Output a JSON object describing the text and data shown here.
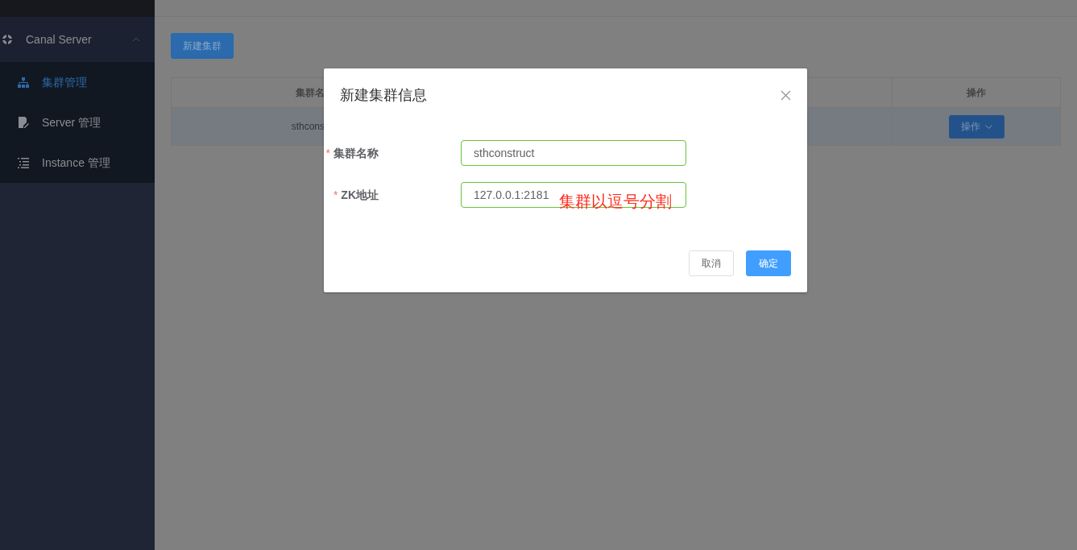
{
  "sidebar": {
    "group": {
      "label": "Canal Server",
      "expanded": true
    },
    "items": [
      {
        "label": "集群管理",
        "selected": true
      },
      {
        "label": "Server 管理",
        "selected": false
      },
      {
        "label": "Instance 管理",
        "selected": false
      }
    ]
  },
  "toolbar": {
    "new_button": "新建集群"
  },
  "table": {
    "columns": [
      "集群名",
      "操作"
    ],
    "rows": [
      {
        "cells": [
          "sthcons"
        ],
        "action": "操作"
      }
    ]
  },
  "dialog": {
    "title": "新建集群信息",
    "fields": [
      {
        "label": "集群名称",
        "required_mark": "*",
        "value": "sthconstruct"
      },
      {
        "label": "ZK地址",
        "required_mark": "*",
        "value": "127.0.0.1:2181"
      }
    ],
    "annotation": "集群以逗号分割",
    "buttons": [
      {
        "label": "取消",
        "kind": "default"
      },
      {
        "label": "确定",
        "kind": "primary"
      }
    ]
  }
}
